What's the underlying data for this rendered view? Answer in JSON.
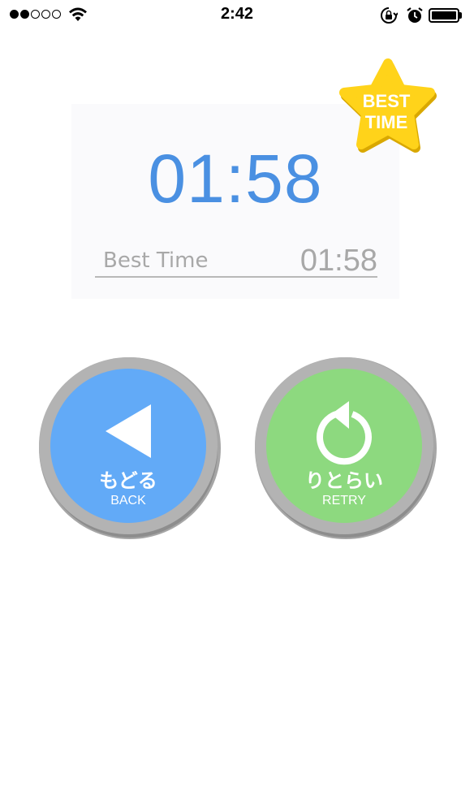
{
  "status_bar": {
    "time": "2:42",
    "signal_filled": 2,
    "signal_total": 5,
    "icons": [
      "wifi-icon",
      "rotation-lock-icon",
      "alarm-icon",
      "battery-icon"
    ]
  },
  "result": {
    "time": "01:58",
    "best_label": "Best Time",
    "best_value": "01:58",
    "badge_line1": "BEST",
    "badge_line2": "TIME"
  },
  "buttons": {
    "back": {
      "label_jp": "もどる",
      "label_en": "BACK",
      "icon": "back-triangle-icon"
    },
    "retry": {
      "label_jp": "りとらい",
      "label_en": "RETRY",
      "icon": "retry-arrow-icon"
    }
  },
  "colors": {
    "time_blue": "#4a90e2",
    "back_blue": "#62aaf7",
    "retry_green": "#8dd97f",
    "badge_yellow": "#ffd31a",
    "ring_gray": "#b3b3b3"
  }
}
